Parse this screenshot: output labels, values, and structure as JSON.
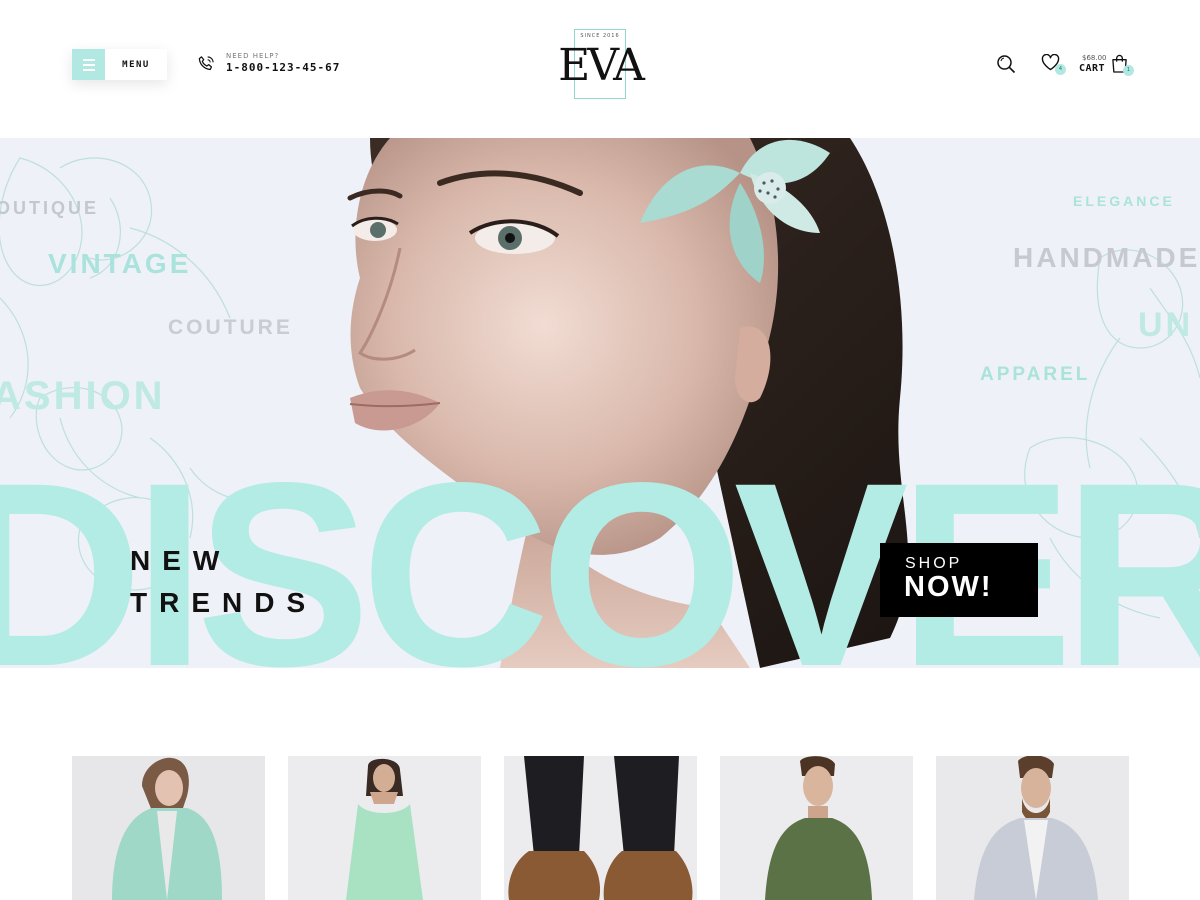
{
  "header": {
    "menu_label": "MENU",
    "help_label": "NEED HELP?",
    "phone": "1-800-123-45-67",
    "logo_since": "SINCE 2016",
    "logo_text": "EVA",
    "wishlist_count": "4",
    "cart_price": "$68.00",
    "cart_label": "CART",
    "cart_count": "1"
  },
  "hero": {
    "bg_words": [
      "OUTIQUE",
      "VINTAGE",
      "COUTURE",
      "ASHION",
      "ELEGANCE",
      "HANDMADE",
      "UN",
      "APPAREL"
    ],
    "big_word": "DISCOVER",
    "headline_line1": "NEW",
    "headline_line2": "TRENDS",
    "cta_top": "SHOP",
    "cta_bottom": "NOW!"
  },
  "colors": {
    "accent": "#b3ebe5",
    "dark": "#000000",
    "hero_bg": "#eef1f7"
  },
  "products": [
    {
      "name": "mint-coat"
    },
    {
      "name": "mint-dress"
    },
    {
      "name": "brown-boots"
    },
    {
      "name": "green-shirt"
    },
    {
      "name": "grey-blazer"
    }
  ]
}
